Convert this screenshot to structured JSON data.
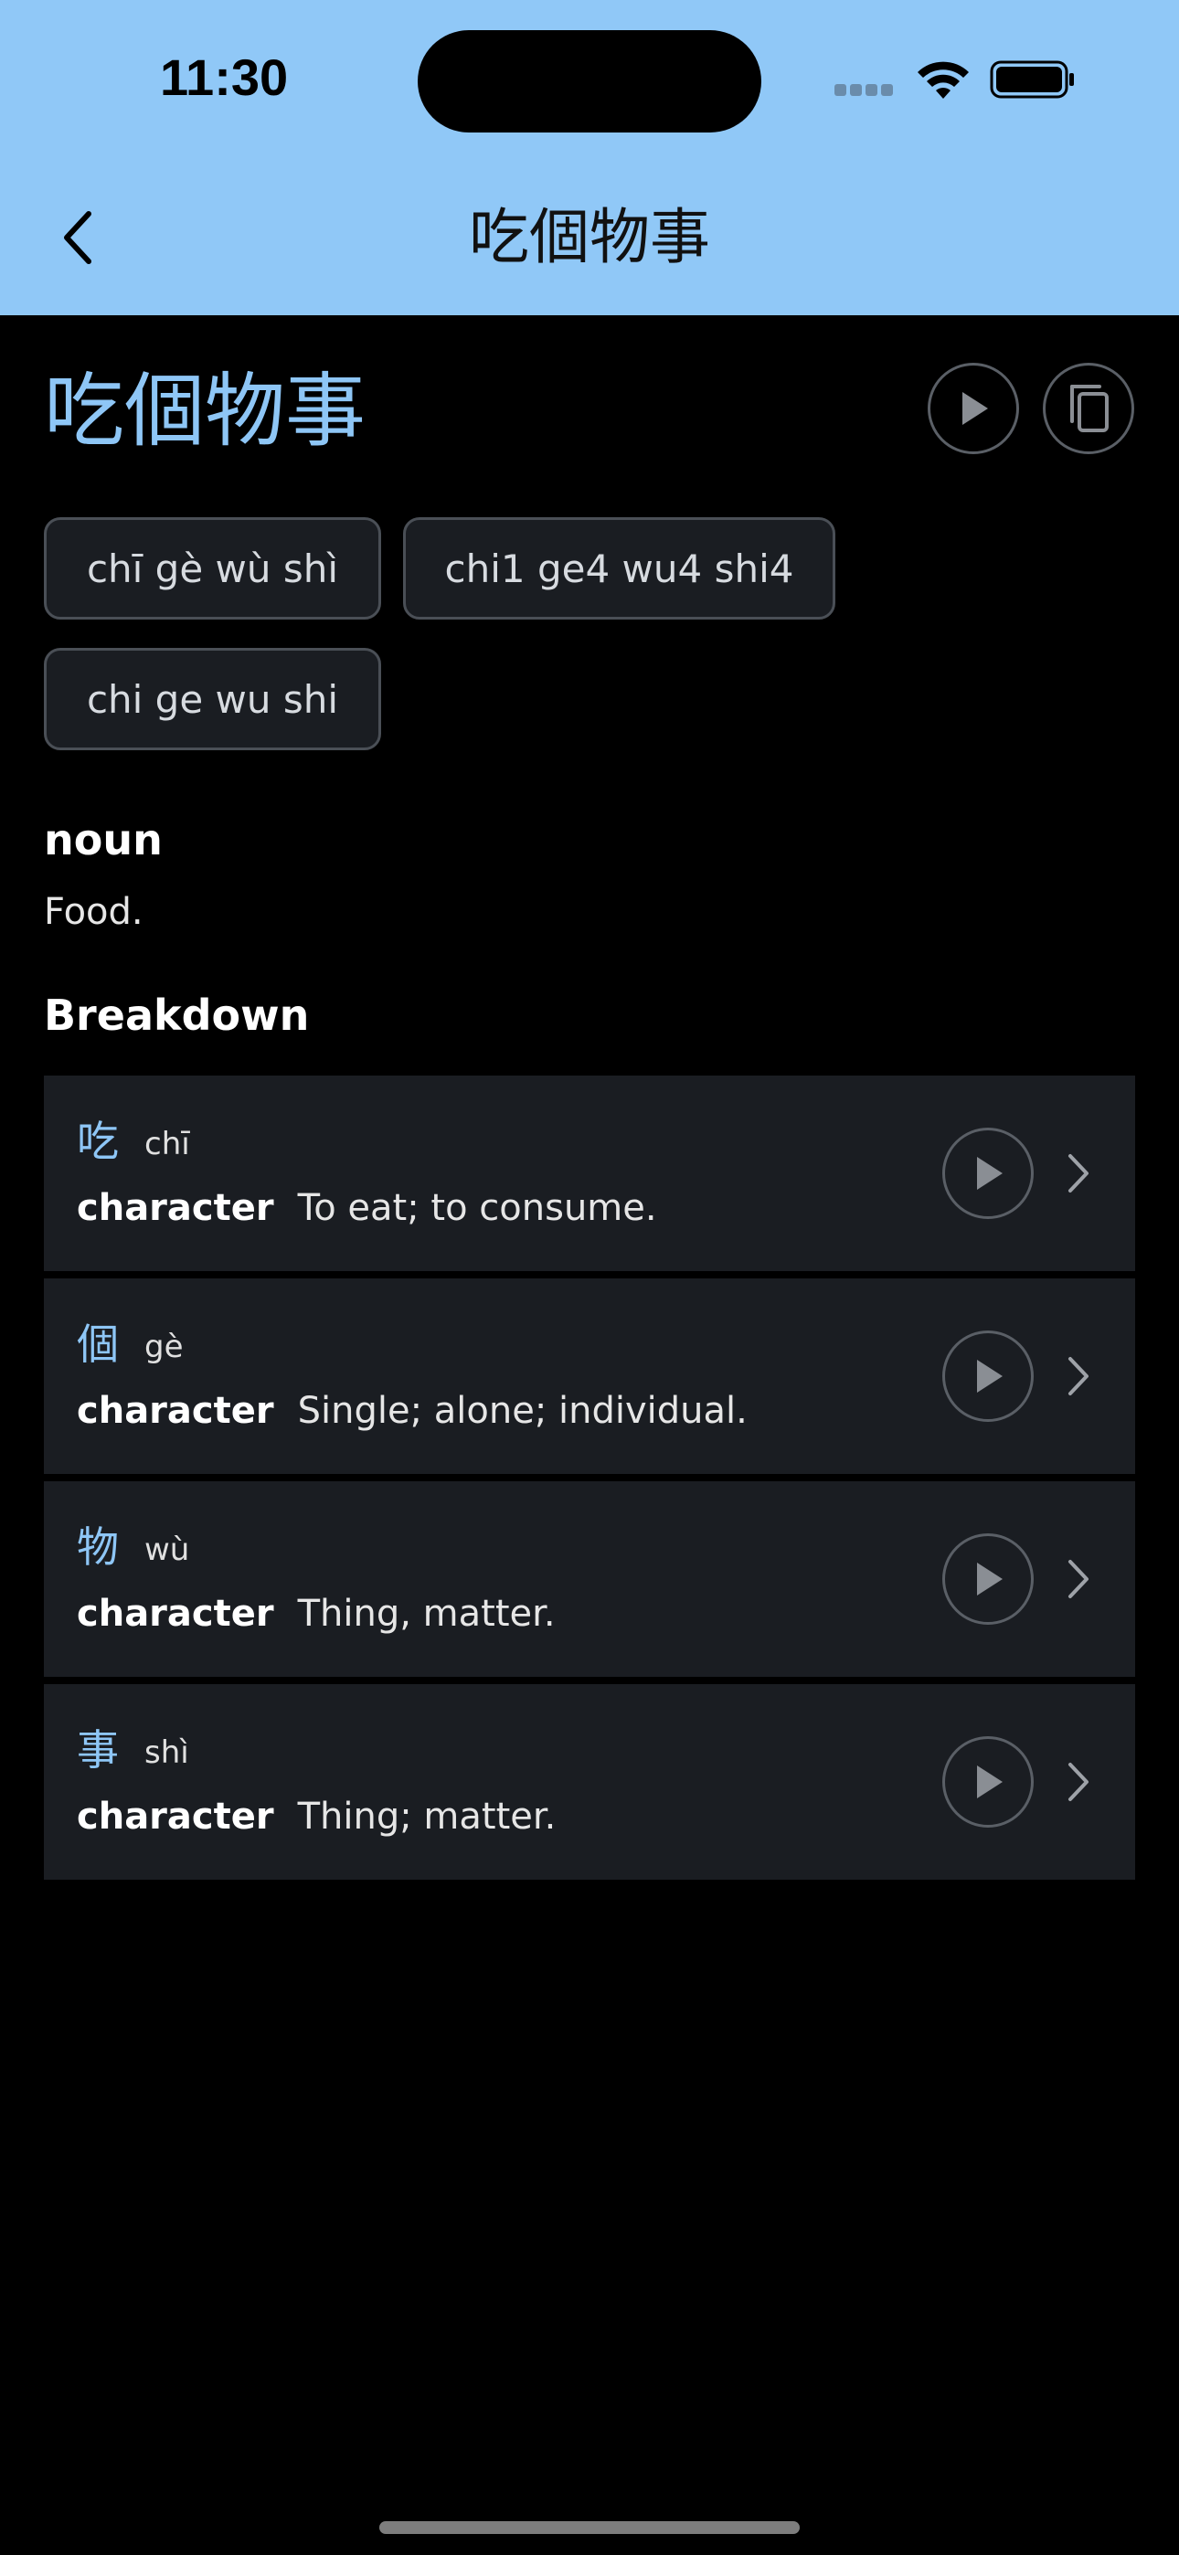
{
  "status": {
    "time": "11:30"
  },
  "nav": {
    "title": "吃個物事"
  },
  "entry": {
    "headword": "吃個物事",
    "romanizations": [
      "chī gè wù shì",
      "chi1 ge4 wu4 shi4",
      "chi ge wu shi"
    ],
    "part_of_speech": "noun",
    "definition": "Food."
  },
  "breakdown": {
    "heading": "Breakdown",
    "items": [
      {
        "char": "吃",
        "pinyin": "chī",
        "type": "character",
        "meaning": "To eat; to consume."
      },
      {
        "char": "個",
        "pinyin": "gè",
        "type": "character",
        "meaning": "Single; alone; individual."
      },
      {
        "char": "物",
        "pinyin": "wù",
        "type": "character",
        "meaning": "Thing, matter."
      },
      {
        "char": "事",
        "pinyin": "shì",
        "type": "character",
        "meaning": "Thing; matter."
      }
    ]
  },
  "icons": {
    "back": "chevron-left-icon",
    "play": "play-icon",
    "copy": "copy-icon",
    "chevron": "chevron-right-icon"
  },
  "colors": {
    "header_bg": "#90c8f7",
    "accent": "#8ec6f6",
    "background": "#000000",
    "card_bg": "#1a1d22"
  }
}
